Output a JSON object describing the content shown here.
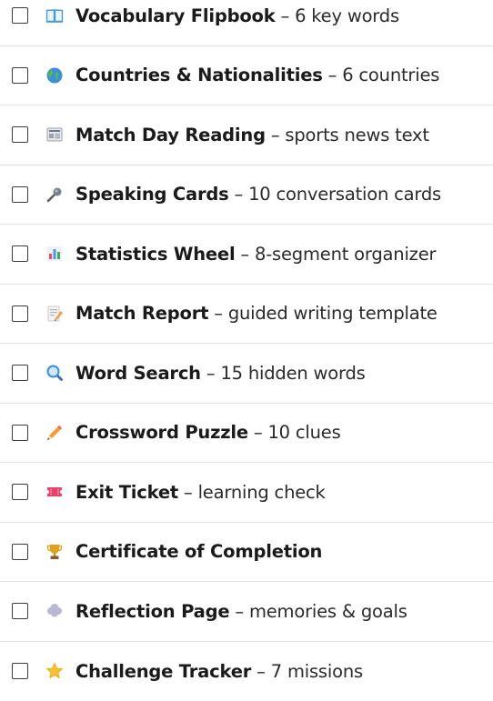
{
  "checklist": {
    "items": [
      {
        "icon": "book-icon",
        "title": "Vocabulary Flipbook",
        "separator": " – ",
        "description": "6 key words"
      },
      {
        "icon": "globe-icon",
        "title": "Countries & Nationalities",
        "separator": " – ",
        "description": "6 countries"
      },
      {
        "icon": "newspaper-icon",
        "title": "Match Day Reading",
        "separator": " – ",
        "description": "sports news text"
      },
      {
        "icon": "microphone-icon",
        "title": "Speaking Cards",
        "separator": " – ",
        "description": "10 conversation cards"
      },
      {
        "icon": "bar-chart-icon",
        "title": "Statistics Wheel",
        "separator": " – ",
        "description": "8-segment organizer"
      },
      {
        "icon": "memo-icon",
        "title": "Match Report",
        "separator": " – ",
        "description": "guided writing template"
      },
      {
        "icon": "magnifier-icon",
        "title": "Word Search",
        "separator": " – ",
        "description": "15 hidden words"
      },
      {
        "icon": "pencil-icon",
        "title": "Crossword Puzzle",
        "separator": " – ",
        "description": "10 clues"
      },
      {
        "icon": "ticket-icon",
        "title": "Exit Ticket",
        "separator": " – ",
        "description": "learning check"
      },
      {
        "icon": "trophy-icon",
        "title": "Certificate of Completion",
        "separator": "",
        "description": ""
      },
      {
        "icon": "thought-bubble-icon",
        "title": "Reflection Page",
        "separator": " – ",
        "description": "memories & goals"
      },
      {
        "icon": "star-icon",
        "title": "Challenge Tracker",
        "separator": " – ",
        "description": "7 missions"
      }
    ]
  }
}
